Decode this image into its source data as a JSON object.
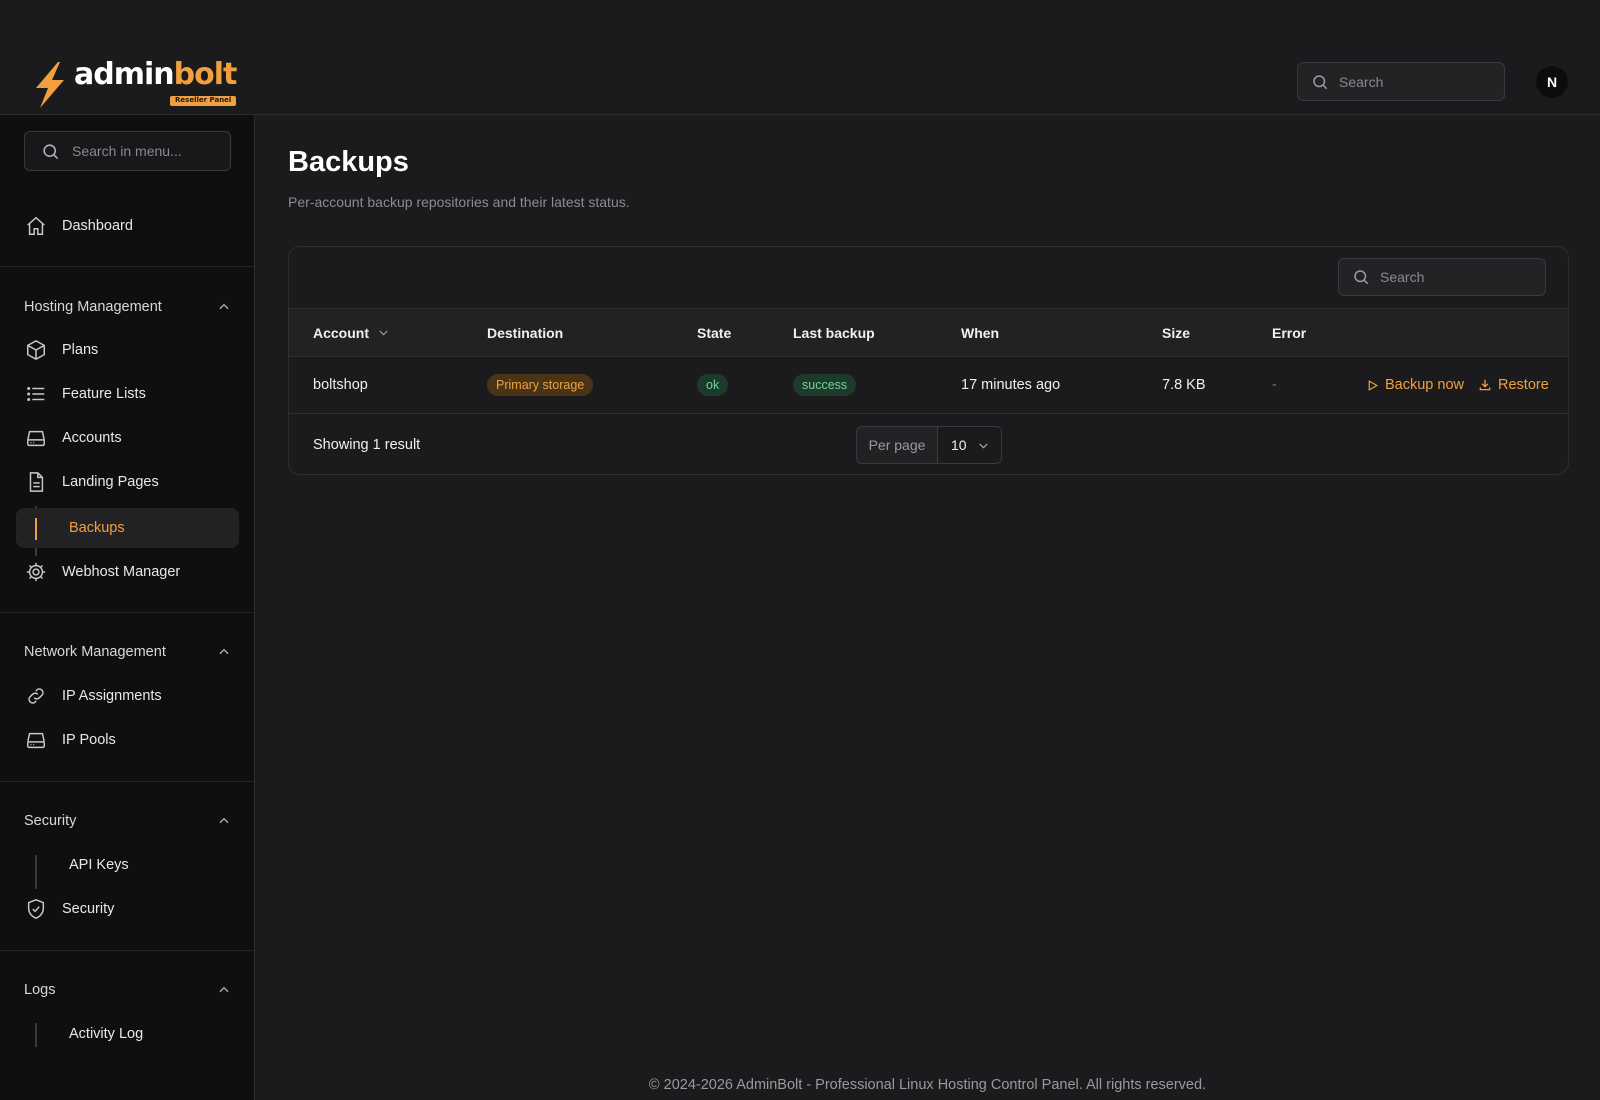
{
  "brand": {
    "name_white": "admin",
    "name_orange": "bolt",
    "badge": "Reseller Panel"
  },
  "header": {
    "search_placeholder": "Search",
    "avatar_initial": "N"
  },
  "sidebar": {
    "search_placeholder": "Search in menu...",
    "dashboard": "Dashboard",
    "groups": [
      {
        "title": "Hosting Management",
        "items": [
          "Plans",
          "Feature Lists",
          "Accounts",
          "Landing Pages",
          "Backups",
          "Webhost Manager"
        ]
      },
      {
        "title": "Network Management",
        "items": [
          "IP Assignments",
          "IP Pools"
        ]
      },
      {
        "title": "Security",
        "items": [
          "API Keys",
          "Security"
        ]
      },
      {
        "title": "Logs",
        "items": [
          "Activity Log"
        ]
      }
    ]
  },
  "page": {
    "title": "Backups",
    "subtitle": "Per-account backup repositories and their latest status."
  },
  "table": {
    "search_placeholder": "Search",
    "columns": [
      "Account",
      "Destination",
      "State",
      "Last backup",
      "When",
      "Size",
      "Error"
    ],
    "rows": [
      {
        "account": "boltshop",
        "destination": "Primary storage",
        "state": "ok",
        "last_backup": "success",
        "when": "17 minutes ago",
        "size": "7.8 KB",
        "error": "-",
        "backup_now": "Backup now",
        "restore": "Restore"
      }
    ],
    "showing": "Showing 1 result",
    "per_page_label": "Per page",
    "per_page_value": "10"
  },
  "footer": "© 2024-2026 AdminBolt - Professional Linux Hosting Control Panel. All rights reserved.",
  "colors": {
    "accent": "#f2a03f",
    "success": "#6fd49a",
    "background": "#1b1b1d",
    "sidebar": "#0f0f10"
  }
}
